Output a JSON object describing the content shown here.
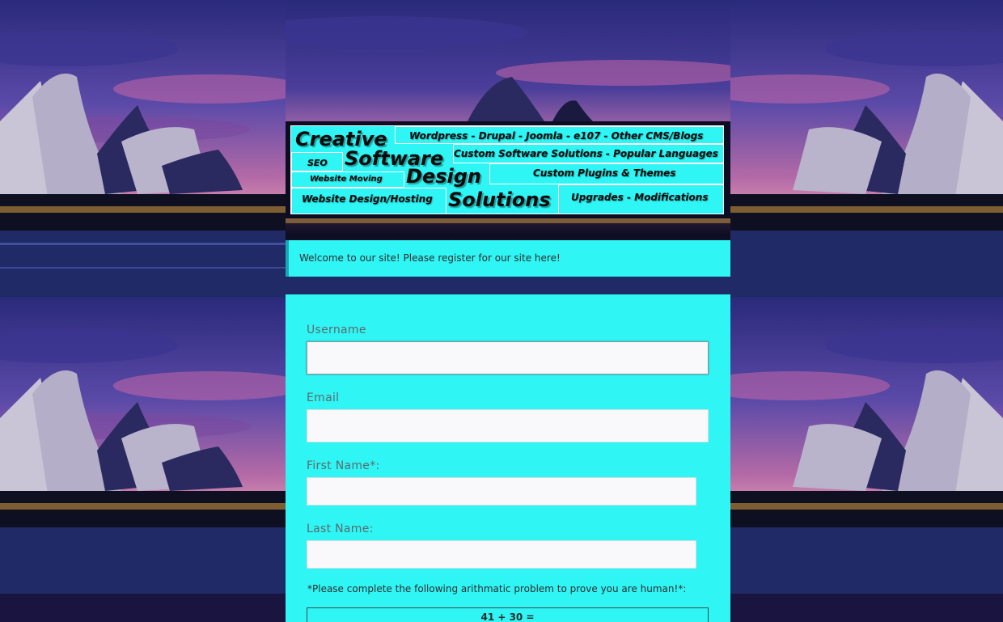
{
  "colors": {
    "panel_cyan": "#2ff5f5",
    "welcome_accent": "#1aa7b5",
    "input_bg": "#f9f9fb",
    "label_grey": "#5e6a6c"
  },
  "background": {
    "scene": "opera-house-at-dusk-icon"
  },
  "logo": {
    "words": {
      "creative": "Creative",
      "software": "Software",
      "design": "Design",
      "solutions": "Solutions"
    },
    "tags": {
      "cms": "Wordpress - Drupal - Joomla - e107 -  Other CMS/Blogs",
      "custom_software": "Custom Software Solutions - Popular Languages",
      "seo": "SEO",
      "plugins": "Custom Plugins & Themes",
      "moving": "Website Moving",
      "hosting": "Website Design/Hosting",
      "upgrades": "Upgrades - Modifications"
    }
  },
  "welcome": {
    "message": "Welcome to our site! Please register for our site here!"
  },
  "form": {
    "username_label": "Username",
    "email_label": "Email",
    "first_name_label": "First Name*:",
    "last_name_label": "Last Name:",
    "username_value": "",
    "email_value": "",
    "first_name_value": "",
    "last_name_value": "",
    "captcha_prompt": "*Please complete the following arithmatic problem to prove you are human!*:",
    "captcha_problem": "41 + 30 ="
  }
}
